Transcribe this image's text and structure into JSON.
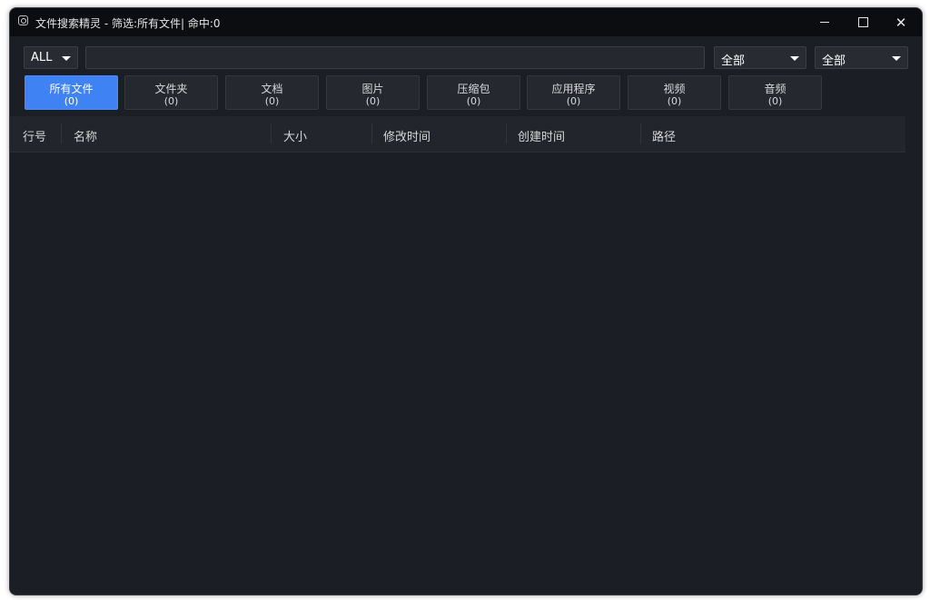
{
  "window": {
    "title": "文件搜索精灵 - 筛选:所有文件| 命中:0",
    "icon": "search-app-icon"
  },
  "toolbar": {
    "scope_select": {
      "value": "ALL"
    },
    "search": {
      "value": "",
      "placeholder": ""
    },
    "filter1": {
      "value": "全部"
    },
    "filter2": {
      "value": "全部"
    }
  },
  "tabs": [
    {
      "label": "所有文件",
      "count": "(0)",
      "active": true
    },
    {
      "label": "文件夹",
      "count": "(0)"
    },
    {
      "label": "文档",
      "count": "(0)"
    },
    {
      "label": "图片",
      "count": "(0)"
    },
    {
      "label": "压缩包",
      "count": "(0)"
    },
    {
      "label": "应用程序",
      "count": "(0)"
    },
    {
      "label": "视频",
      "count": "(0)"
    },
    {
      "label": "音频",
      "count": "(0)"
    }
  ],
  "table": {
    "columns": [
      "行号",
      "名称",
      "大小",
      "修改时间",
      "创建时间",
      "路径"
    ],
    "rows": []
  },
  "colors": {
    "accent": "#3f82f4",
    "background": "#1b1e24",
    "titlebar": "#0c0d10"
  }
}
